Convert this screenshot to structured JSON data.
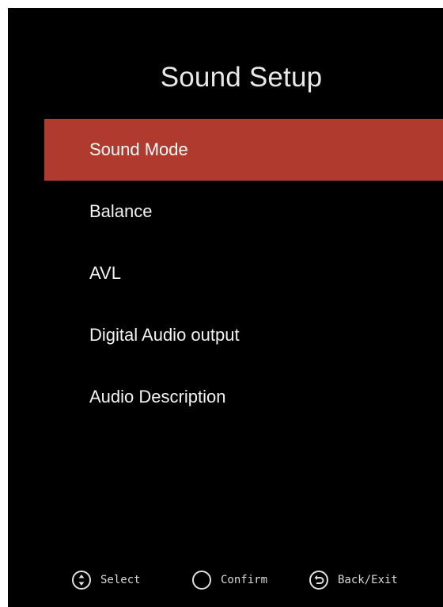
{
  "screen": {
    "title": "Sound Setup"
  },
  "menu": {
    "items": [
      {
        "label": "Sound Mode",
        "selected": true
      },
      {
        "label": "Balance",
        "selected": false
      },
      {
        "label": "AVL",
        "selected": false
      },
      {
        "label": "Digital Audio output",
        "selected": false
      },
      {
        "label": "Audio Description",
        "selected": false
      }
    ]
  },
  "footer": {
    "select": {
      "label": "Select",
      "icon": "up-down-arrow-icon"
    },
    "confirm": {
      "label": "Confirm",
      "icon": "ok-circle-icon"
    },
    "back": {
      "label": "Back/Exit",
      "icon": "back-arrow-icon"
    }
  },
  "colors": {
    "background": "#000000",
    "highlight": "#b03a2e",
    "text": "#ffffff"
  }
}
